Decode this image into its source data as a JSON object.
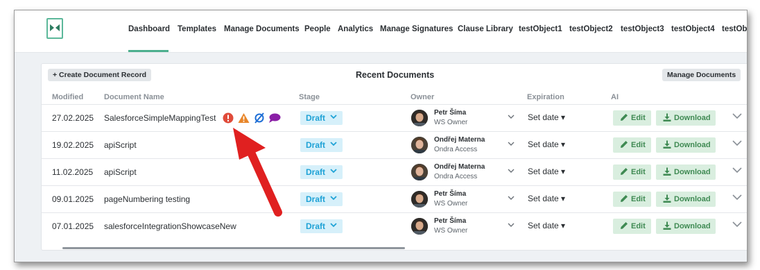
{
  "nav": {
    "items": [
      "Dashboard",
      "Templates",
      "Manage Documents",
      "People",
      "Analytics",
      "Manage Signatures",
      "Clause Library",
      "testObject1",
      "testObject2",
      "testObject3",
      "testObject4",
      "testOb"
    ],
    "active": "Dashboard"
  },
  "card": {
    "create_button": "+ Create Document Record",
    "title": "Recent Documents",
    "manage_button": "Manage Documents",
    "columns": {
      "modified": "Modified",
      "name": "Document Name",
      "stage": "Stage",
      "owner": "Owner",
      "expiration": "Expiration",
      "ai": "AI"
    }
  },
  "rows": [
    {
      "modified": "27.02.2025",
      "name": "SalesforceSimpleMappingTest",
      "stage": "Draft",
      "owner": "Petr Šíma",
      "role": "WS Owner",
      "expiration": "Set date",
      "edit": "Edit",
      "download": "Download"
    },
    {
      "modified": "19.02.2025",
      "name": "apiScript",
      "stage": "Draft",
      "owner": "Ondřej Materna",
      "role": "Ondra Access",
      "expiration": "Set date",
      "edit": "Edit",
      "download": "Download"
    },
    {
      "modified": "11.02.2025",
      "name": "apiScript",
      "stage": "Draft",
      "owner": "Ondřej Materna",
      "role": "Ondra Access",
      "expiration": "Set date",
      "edit": "Edit",
      "download": "Download"
    },
    {
      "modified": "09.01.2025",
      "name": "pageNumbering testing",
      "stage": "Draft",
      "owner": "Petr Šíma",
      "role": "WS Owner",
      "expiration": "Set date",
      "edit": "Edit",
      "download": "Download"
    },
    {
      "modified": "07.01.2025",
      "name": "salesforceIntegrationShowcaseNew",
      "stage": "Draft",
      "owner": "Petr Šíma",
      "role": "WS Owner",
      "expiration": "Set date",
      "edit": "Edit",
      "download": "Download"
    }
  ],
  "status_icons": [
    "error-icon",
    "warning-icon",
    "no-mapping-icon",
    "comment-icon"
  ],
  "colors": {
    "accent": "#4caf8e",
    "stage_bg": "#d6f0fa",
    "stage_text": "#1fa2d6",
    "button_green_bg": "#d9eedf",
    "button_green_text": "#3f8a53",
    "error": "#e04b3a",
    "warning": "#e8862a",
    "no_mapping": "#1f6fd6",
    "comment": "#8a1fa6",
    "annotation_arrow": "#e02020"
  }
}
